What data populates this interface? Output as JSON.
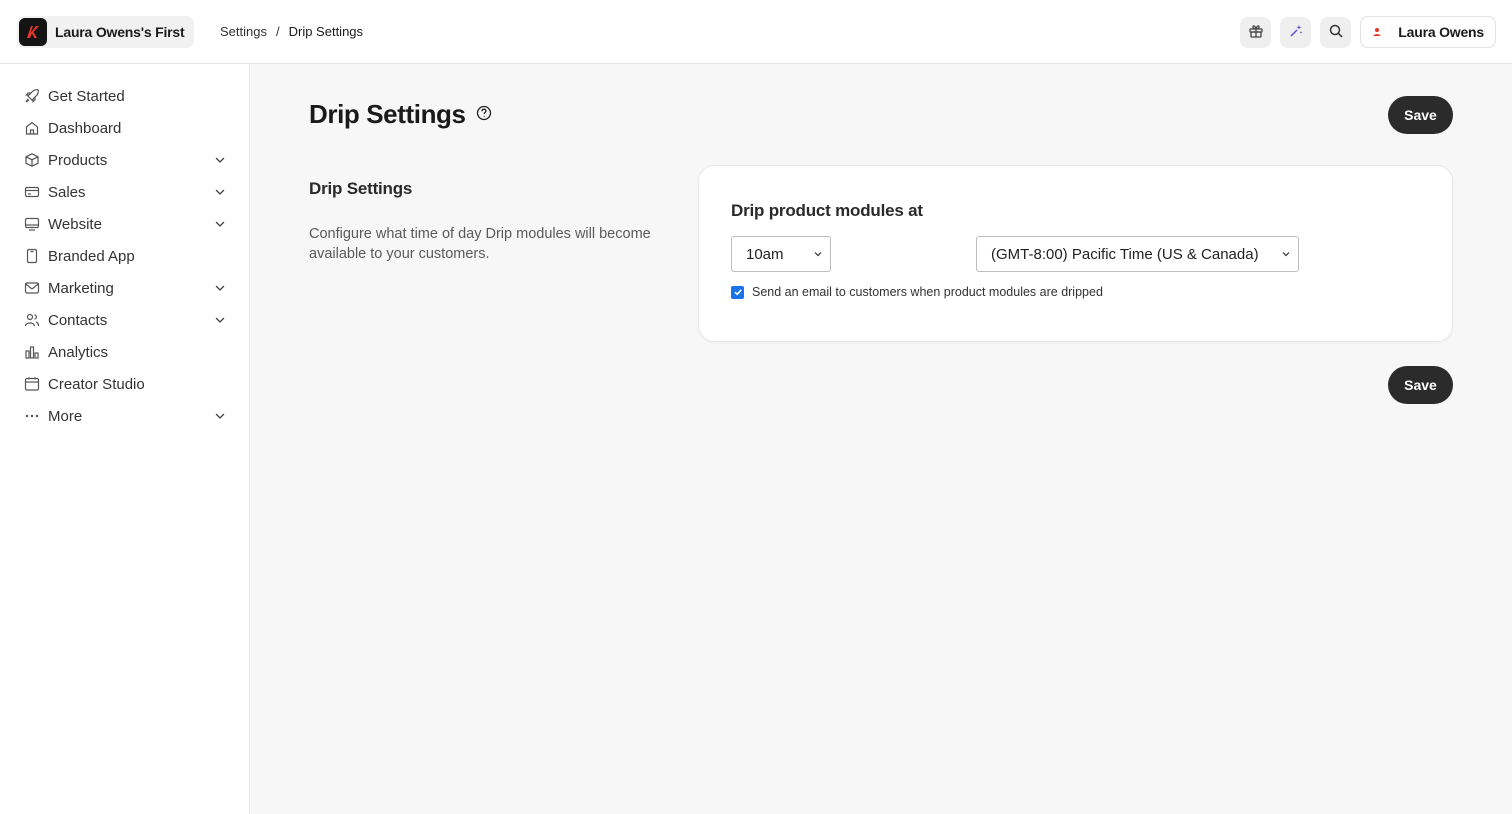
{
  "header": {
    "brand_name": "Laura Owens's First",
    "breadcrumb": {
      "parent": "Settings",
      "separator": "/",
      "current": "Drip Settings"
    },
    "user_name": "Laura Owens"
  },
  "sidebar": {
    "items": [
      {
        "label": "Get Started",
        "icon": "rocket-icon",
        "has_children": false
      },
      {
        "label": "Dashboard",
        "icon": "home-icon",
        "has_children": false
      },
      {
        "label": "Products",
        "icon": "box-icon",
        "has_children": true
      },
      {
        "label": "Sales",
        "icon": "credit-card-icon",
        "has_children": true
      },
      {
        "label": "Website",
        "icon": "monitor-icon",
        "has_children": true
      },
      {
        "label": "Branded App",
        "icon": "mobile-icon",
        "has_children": false
      },
      {
        "label": "Marketing",
        "icon": "mail-icon",
        "has_children": true
      },
      {
        "label": "Contacts",
        "icon": "users-icon",
        "has_children": true
      },
      {
        "label": "Analytics",
        "icon": "bar-chart-icon",
        "has_children": false
      },
      {
        "label": "Creator Studio",
        "icon": "calendar-icon",
        "has_children": false
      },
      {
        "label": "More",
        "icon": "more-dots-icon",
        "has_children": true
      }
    ]
  },
  "main": {
    "page_title": "Drip Settings",
    "save_label": "Save",
    "section_title": "Drip Settings",
    "section_description": "Configure what time of day Drip modules will become available to your customers.",
    "card": {
      "title": "Drip product modules at",
      "time_value": "10am",
      "timezone_value": "(GMT-8:00) Pacific Time (US & Canada)",
      "email_checkbox_label": "Send an email to customers when product modules are dripped",
      "email_checkbox_checked": true
    }
  },
  "colors": {
    "brand_red": "#e8352b",
    "save_button_bg": "#2b2b2b",
    "checkbox_blue": "#1a73e8",
    "magic_icon_purple": "#5b4bd6"
  }
}
